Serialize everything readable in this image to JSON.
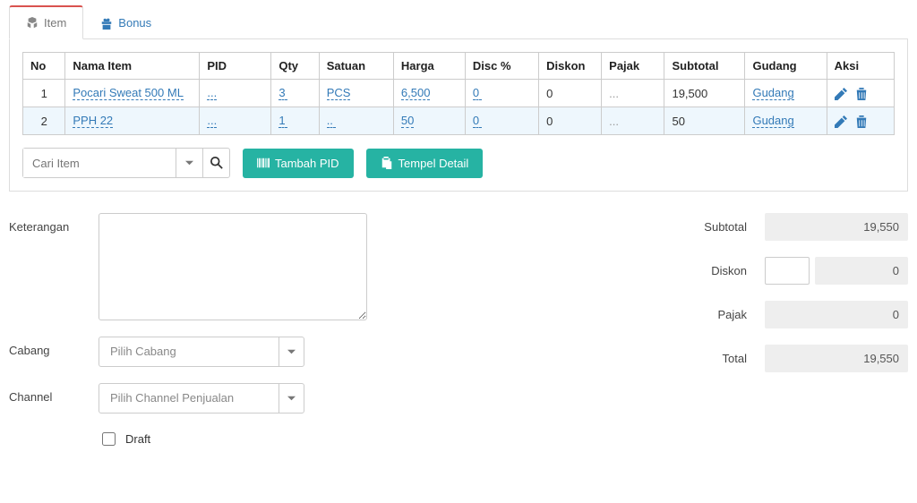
{
  "tabs": {
    "item": "Item",
    "bonus": "Bonus"
  },
  "headers": {
    "no": "No",
    "nama": "Nama Item",
    "pid": "PID",
    "qty": "Qty",
    "satuan": "Satuan",
    "harga": "Harga",
    "discp": "Disc %",
    "diskon": "Diskon",
    "pajak": "Pajak",
    "subtotal": "Subtotal",
    "gudang": "Gudang",
    "aksi": "Aksi"
  },
  "rows": [
    {
      "no": "1",
      "nama": "Pocari Sweat 500 ML",
      "pid": "...",
      "qty": "3",
      "satuan": "PCS",
      "harga": "6,500",
      "discp": "0",
      "diskon": "0",
      "pajak": "...",
      "subtotal": "19,500",
      "gudang": "Gudang"
    },
    {
      "no": "2",
      "nama": "PPH 22",
      "pid": "...",
      "qty": "1",
      "satuan": "..",
      "harga": "50",
      "discp": "0",
      "diskon": "0",
      "pajak": "...",
      "subtotal": "50",
      "gudang": "Gudang"
    }
  ],
  "toolbar": {
    "search_placeholder": "Cari Item",
    "tambah_pid": "Tambah PID",
    "tempel_detail": "Tempel Detail"
  },
  "form": {
    "keterangan_label": "Keterangan",
    "cabang_label": "Cabang",
    "cabang_placeholder": "Pilih Cabang",
    "channel_label": "Channel",
    "channel_placeholder": "Pilih Channel Penjualan",
    "draft_label": "Draft"
  },
  "totals": {
    "subtotal_label": "Subtotal",
    "subtotal_value": "19,550",
    "diskon_label": "Diskon",
    "diskon_input": "",
    "diskon_value": "0",
    "pajak_label": "Pajak",
    "pajak_value": "0",
    "total_label": "Total",
    "total_value": "19,550"
  }
}
